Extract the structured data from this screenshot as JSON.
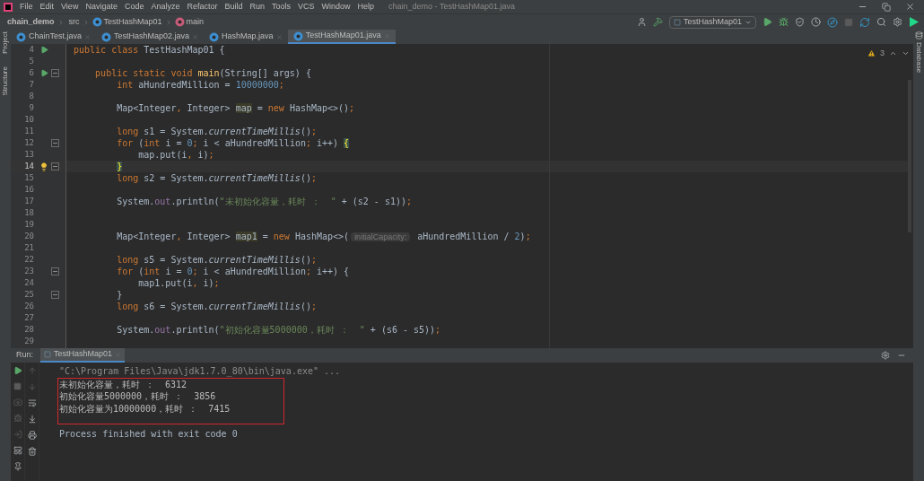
{
  "window": {
    "title": "chain_demo - TestHashMap01.java"
  },
  "menu": [
    "File",
    "Edit",
    "View",
    "Navigate",
    "Code",
    "Analyze",
    "Refactor",
    "Build",
    "Run",
    "Tools",
    "VCS",
    "Window",
    "Help"
  ],
  "breadcrumbs": [
    {
      "label": "chain_demo",
      "kind": "project"
    },
    {
      "label": "src",
      "kind": "folder"
    },
    {
      "label": "TestHashMap01",
      "kind": "class"
    },
    {
      "label": "main",
      "kind": "method"
    }
  ],
  "run_config": "TestHashMap01",
  "left_tools": [
    "Project",
    "Structure"
  ],
  "right_tools": [
    "Database"
  ],
  "tabs": [
    {
      "label": "ChainTest.java",
      "selected": false
    },
    {
      "label": "TestHashMap02.java",
      "selected": false
    },
    {
      "label": "HashMap.java",
      "selected": false
    },
    {
      "label": "TestHashMap01.java",
      "selected": true
    }
  ],
  "editor": {
    "warnings": "3",
    "lines": [
      {
        "number": "4",
        "markers": [
          {
            "kind": "run"
          }
        ],
        "tokens": [
          {
            "text": "public class ",
            "kind": "kw"
          },
          {
            "text": "TestHashMap01 {",
            "kind": "plain"
          }
        ]
      },
      {
        "number": "5"
      },
      {
        "number": "6",
        "markers": [
          {
            "kind": "run"
          },
          {
            "kind": "fold"
          }
        ],
        "tokens": [
          {
            "text": "    public static void ",
            "kind": "kw"
          },
          {
            "text": "main",
            "kind": "method"
          },
          {
            "text": "(String[] args) {",
            "kind": "plain"
          }
        ]
      },
      {
        "number": "7",
        "tokens": [
          {
            "text": "        int ",
            "kind": "kw"
          },
          {
            "text": "aHundredMillion = ",
            "kind": "plain"
          },
          {
            "text": "10000000",
            "kind": "num"
          },
          {
            "text": ";",
            "kind": "kw"
          }
        ]
      },
      {
        "number": "8"
      },
      {
        "number": "9",
        "tokens": [
          {
            "text": "        Map<Integer",
            "kind": "plain"
          },
          {
            "text": ", ",
            "kind": "kw"
          },
          {
            "text": "Integer> ",
            "kind": "plain"
          },
          {
            "text": "map",
            "kind": "hl"
          },
          {
            "text": " = ",
            "kind": "plain"
          },
          {
            "text": "new ",
            "kind": "kw"
          },
          {
            "text": "HashMap<>()",
            "kind": "plain"
          },
          {
            "text": ";",
            "kind": "kw"
          }
        ]
      },
      {
        "number": "10"
      },
      {
        "number": "11",
        "tokens": [
          {
            "text": "        long ",
            "kind": "kw"
          },
          {
            "text": "s1 = System.",
            "kind": "plain"
          },
          {
            "text": "currentTimeMillis",
            "kind": "italic"
          },
          {
            "text": "()",
            "kind": "plain"
          },
          {
            "text": ";",
            "kind": "kw"
          }
        ]
      },
      {
        "number": "12",
        "markers": [
          {
            "kind": "fold"
          }
        ],
        "tokens": [
          {
            "text": "        for ",
            "kind": "kw"
          },
          {
            "text": "(",
            "kind": "plain"
          },
          {
            "text": "int ",
            "kind": "kw"
          },
          {
            "text": "i = ",
            "kind": "plain"
          },
          {
            "text": "0",
            "kind": "num"
          },
          {
            "text": "; ",
            "kind": "kw"
          },
          {
            "text": "i < aHundredMillion",
            "kind": "plain"
          },
          {
            "text": "; ",
            "kind": "kw"
          },
          {
            "text": "i++) ",
            "kind": "plain"
          },
          {
            "text": "{",
            "kind": "brace"
          }
        ]
      },
      {
        "number": "13",
        "tokens": [
          {
            "text": "            map.put(i",
            "kind": "plain"
          },
          {
            "text": ", ",
            "kind": "kw"
          },
          {
            "text": "i)",
            "kind": "plain"
          },
          {
            "text": ";",
            "kind": "kw"
          }
        ]
      },
      {
        "number": "14",
        "current": true,
        "markers": [
          {
            "kind": "bulb"
          },
          {
            "kind": "fold"
          }
        ],
        "tokens": [
          {
            "text": "        }",
            "kind": "brace"
          }
        ]
      },
      {
        "number": "15",
        "tokens": [
          {
            "text": "        long ",
            "kind": "kw"
          },
          {
            "text": "s2 = System.",
            "kind": "plain"
          },
          {
            "text": "currentTimeMillis",
            "kind": "italic"
          },
          {
            "text": "()",
            "kind": "plain"
          },
          {
            "text": ";",
            "kind": "kw"
          }
        ]
      },
      {
        "number": "16"
      },
      {
        "number": "17",
        "tokens": [
          {
            "text": "        System.",
            "kind": "plain"
          },
          {
            "text": "out",
            "kind": "field"
          },
          {
            "text": ".println(",
            "kind": "plain"
          },
          {
            "text": "\"未初始化容量，耗时 ：  \"",
            "kind": "str"
          },
          {
            "text": " + (s2 - s1))",
            "kind": "plain"
          },
          {
            "text": ";",
            "kind": "kw"
          }
        ]
      },
      {
        "number": "18"
      },
      {
        "number": "19"
      },
      {
        "number": "20",
        "tokens": [
          {
            "text": "        Map<Integer",
            "kind": "plain"
          },
          {
            "text": ", ",
            "kind": "kw"
          },
          {
            "text": "Integer> ",
            "kind": "plain"
          },
          {
            "text": "map1",
            "kind": "hl"
          },
          {
            "text": " = ",
            "kind": "plain"
          },
          {
            "text": "new ",
            "kind": "kw"
          },
          {
            "text": "HashMap<>(",
            "kind": "plain"
          },
          {
            "text": "initialCapacity:",
            "kind": "hint"
          },
          {
            "text": " aHundredMillion / ",
            "kind": "plain"
          },
          {
            "text": "2",
            "kind": "num"
          },
          {
            "text": ")",
            "kind": "plain"
          },
          {
            "text": ";",
            "kind": "kw"
          }
        ]
      },
      {
        "number": "21"
      },
      {
        "number": "22",
        "tokens": [
          {
            "text": "        long ",
            "kind": "kw"
          },
          {
            "text": "s5 = System.",
            "kind": "plain"
          },
          {
            "text": "currentTimeMillis",
            "kind": "italic"
          },
          {
            "text": "()",
            "kind": "plain"
          },
          {
            "text": ";",
            "kind": "kw"
          }
        ]
      },
      {
        "number": "23",
        "markers": [
          {
            "kind": "fold"
          }
        ],
        "tokens": [
          {
            "text": "        for ",
            "kind": "kw"
          },
          {
            "text": "(",
            "kind": "plain"
          },
          {
            "text": "int ",
            "kind": "kw"
          },
          {
            "text": "i = ",
            "kind": "plain"
          },
          {
            "text": "0",
            "kind": "num"
          },
          {
            "text": "; ",
            "kind": "kw"
          },
          {
            "text": "i < aHundredMillion",
            "kind": "plain"
          },
          {
            "text": "; ",
            "kind": "kw"
          },
          {
            "text": "i++) {",
            "kind": "plain"
          }
        ]
      },
      {
        "number": "24",
        "tokens": [
          {
            "text": "            map1.put(i",
            "kind": "plain"
          },
          {
            "text": ", ",
            "kind": "kw"
          },
          {
            "text": "i)",
            "kind": "plain"
          },
          {
            "text": ";",
            "kind": "kw"
          }
        ]
      },
      {
        "number": "25",
        "markers": [
          {
            "kind": "fold"
          }
        ],
        "tokens": [
          {
            "text": "        }",
            "kind": "plain"
          }
        ]
      },
      {
        "number": "26",
        "tokens": [
          {
            "text": "        long ",
            "kind": "kw"
          },
          {
            "text": "s6 = System.",
            "kind": "plain"
          },
          {
            "text": "currentTimeMillis",
            "kind": "italic"
          },
          {
            "text": "()",
            "kind": "plain"
          },
          {
            "text": ";",
            "kind": "kw"
          }
        ]
      },
      {
        "number": "27"
      },
      {
        "number": "28",
        "tokens": [
          {
            "text": "        System.",
            "kind": "plain"
          },
          {
            "text": "out",
            "kind": "field"
          },
          {
            "text": ".println(",
            "kind": "plain"
          },
          {
            "text": "\"初始化容量5000000，耗时 ：  \"",
            "kind": "str"
          },
          {
            "text": " + (s6 - s5))",
            "kind": "plain"
          },
          {
            "text": ";",
            "kind": "kw"
          }
        ]
      },
      {
        "number": "29"
      }
    ]
  },
  "run_panel": {
    "label": "Run:",
    "tab": {
      "label": "TestHashMap01",
      "selected": true
    },
    "output": [
      {
        "text": "\"C:\\Program Files\\Java\\jdk1.7.0_80\\bin\\java.exe\" ...",
        "kind": "command",
        "framed": false
      },
      {
        "text": "未初始化容量，耗时 ：  6312",
        "kind": "stdout",
        "framed": true
      },
      {
        "text": "初始化容量5000000，耗时 ：  3856",
        "kind": "stdout",
        "framed": true
      },
      {
        "text": "初始化容量为10000000，耗时 ：  7415",
        "kind": "stdout",
        "framed": true
      },
      {
        "text": "Process finished with exit code 0",
        "kind": "status",
        "framed": false
      }
    ]
  }
}
